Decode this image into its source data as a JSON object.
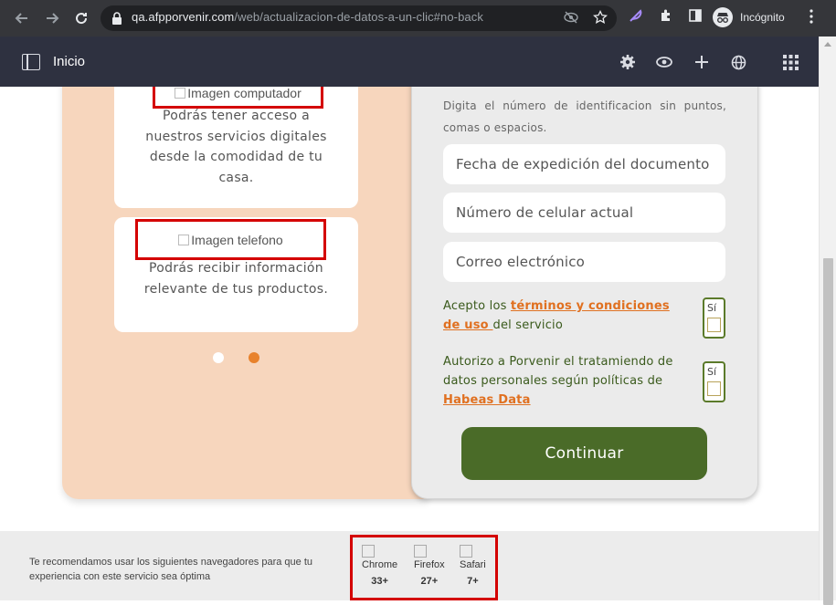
{
  "browser": {
    "url_host": "qa.afpporvenir.com",
    "url_path": "/web/actualizacion-de-datos-a-un-clic#no-back",
    "incognito_label": "Incógnito"
  },
  "header": {
    "title": "Inicio"
  },
  "cards": [
    {
      "image_alt": "Imagen computador",
      "description": "Podrás tener acceso a nuestros servicios digitales desde la comodidad de tu casa."
    },
    {
      "image_alt": "Imagen telefono",
      "description": "Podrás recibir información relevante de tus productos."
    }
  ],
  "carousel": {
    "dot_count": 2,
    "active_index": 1
  },
  "form": {
    "instruction": "Digita el número de identificacion sin puntos, comas o espacios.",
    "fields": [
      {
        "placeholder": "Fecha de expedición del documento"
      },
      {
        "placeholder": "Número de celular actual"
      },
      {
        "placeholder": "Correo electrónico"
      }
    ],
    "consents": [
      {
        "prefix": "Acepto los ",
        "link": "términos y condiciones de uso ",
        "suffix": "del servicio",
        "checkbox_label": "Sí"
      },
      {
        "prefix": "Autorizo a Porvenir el tratamiendo de datos personales según políticas de ",
        "link": "Habeas Data",
        "suffix": "",
        "checkbox_label": "Sí"
      }
    ],
    "submit_label": "Continuar"
  },
  "footer": {
    "recommendation": "Te recomendamos usar los siguientes navegadores para que tu experiencia con este servicio sea óptima",
    "browsers": [
      {
        "name": "Chrome",
        "version": "33+"
      },
      {
        "name": "Firefox",
        "version": "27+"
      },
      {
        "name": "Safari",
        "version": "7+"
      }
    ]
  },
  "colors": {
    "accent_green": "#4a6b28",
    "accent_orange": "#e8822c",
    "peach": "#f7d6bd",
    "highlight_red": "#d40000"
  }
}
